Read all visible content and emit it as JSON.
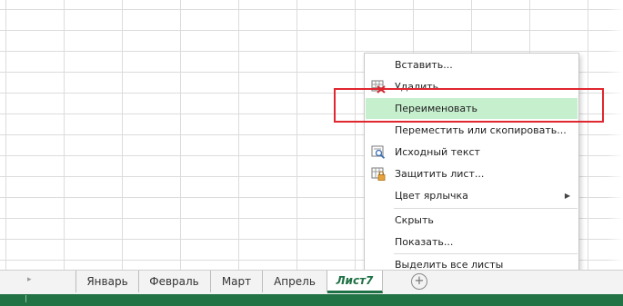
{
  "context_menu": {
    "items": [
      {
        "label": "Вставить...",
        "icon": "insert"
      },
      {
        "label": "Удалить",
        "icon": "delete-sheet-icon"
      },
      {
        "label": "Переименовать",
        "highlighted": true
      },
      {
        "label": "Переместить или скопировать..."
      },
      {
        "label": "Исходный текст",
        "icon": "view-code-icon"
      },
      {
        "label": "Защитить лист...",
        "icon": "protect-sheet-icon"
      },
      {
        "label": "Цвет ярлычка",
        "submenu": true
      },
      {
        "label": "Скрыть"
      },
      {
        "label": "Показать..."
      },
      {
        "label": "Выделить все листы"
      }
    ]
  },
  "sheet_tabs": {
    "tabs": [
      {
        "label": "Январь"
      },
      {
        "label": "Февраль"
      },
      {
        "label": "Март"
      },
      {
        "label": "Апрель"
      },
      {
        "label": "Лист7",
        "active": true
      }
    ],
    "add_icon": "+",
    "scroll_icon": "▸"
  },
  "colors": {
    "accent": "#217346",
    "highlight": "#c6efce",
    "annotation": "#e0262f"
  }
}
